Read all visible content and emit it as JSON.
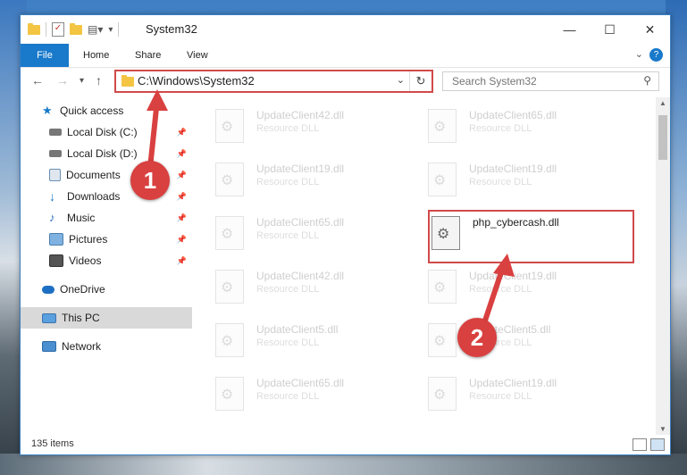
{
  "window": {
    "title": "System32",
    "controls": {
      "minimize": "—",
      "maximize": "☐",
      "close": "✕"
    }
  },
  "ribbon": {
    "tabs": [
      "File",
      "Home",
      "Share",
      "View"
    ],
    "help": "?"
  },
  "address_bar": {
    "path": "C:\\Windows\\System32"
  },
  "search": {
    "placeholder": "Search System32"
  },
  "sidebar": {
    "items": [
      {
        "label": "Quick access",
        "icon": "star-icon",
        "pinned": false
      },
      {
        "label": "Local Disk (C:)",
        "icon": "drive-icon",
        "pinned": true
      },
      {
        "label": "Local Disk (D:)",
        "icon": "drive-icon",
        "pinned": true
      },
      {
        "label": "Documents",
        "icon": "documents-icon",
        "pinned": true
      },
      {
        "label": "Downloads",
        "icon": "download-icon",
        "pinned": true
      },
      {
        "label": "Music",
        "icon": "music-icon",
        "pinned": true
      },
      {
        "label": "Pictures",
        "icon": "pictures-icon",
        "pinned": true
      },
      {
        "label": "Videos",
        "icon": "videos-icon",
        "pinned": true
      },
      {
        "label": "OneDrive",
        "icon": "cloud-icon",
        "pinned": false
      },
      {
        "label": "This PC",
        "icon": "computer-icon",
        "pinned": false,
        "selected": true
      },
      {
        "label": "Network",
        "icon": "network-icon",
        "pinned": false
      }
    ]
  },
  "files": [
    {
      "name": "UpdateClient42.dll",
      "type": "Resource DLL"
    },
    {
      "name": "UpdateClient65.dll",
      "type": "Resource DLL"
    },
    {
      "name": "UpdateClient19.dll",
      "type": "Resource DLL"
    },
    {
      "name": "UpdateClient19.dll",
      "type": "Resource DLL"
    },
    {
      "name": "UpdateClient65.dll",
      "type": "Resource DLL"
    },
    {
      "name": "php_cybercash.dll",
      "type": ""
    },
    {
      "name": "UpdateClient42.dll",
      "type": "Resource DLL"
    },
    {
      "name": "UpdateClient19.dll",
      "type": "Resource DLL"
    },
    {
      "name": "UpdateClient5.dll",
      "type": "Resource DLL"
    },
    {
      "name": "UpdateClient5.dll",
      "type": "Resource DLL"
    },
    {
      "name": "UpdateClient65.dll",
      "type": "Resource DLL"
    },
    {
      "name": "UpdateClient19.dll",
      "type": "Resource DLL"
    }
  ],
  "status": {
    "item_count": "135 items"
  },
  "callouts": [
    "1",
    "2"
  ],
  "colors": {
    "accent": "#1979ca",
    "highlight": "#d14a4a",
    "callout": "#d94040"
  }
}
